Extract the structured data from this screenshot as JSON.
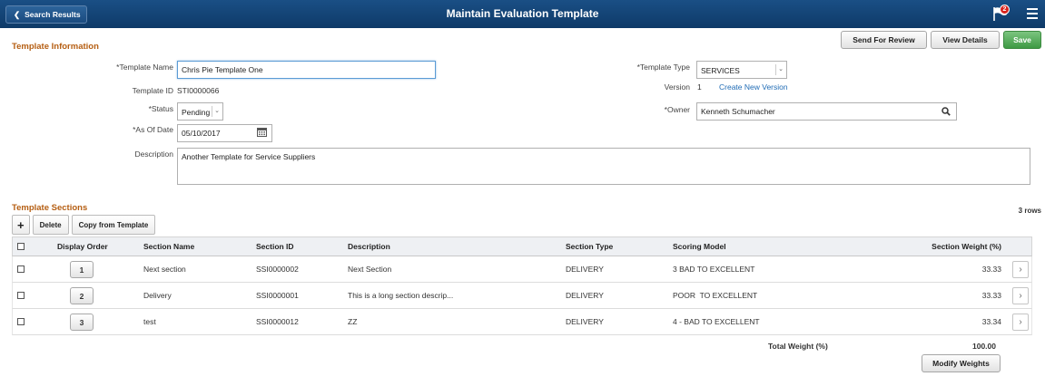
{
  "header": {
    "back_label": "Search Results",
    "title": "Maintain Evaluation Template",
    "notification_count": "2"
  },
  "actions": {
    "send_for_review": "Send For Review",
    "view_details": "View Details",
    "save": "Save"
  },
  "template_info": {
    "section_title": "Template Information",
    "template_name_label": "*Template Name",
    "template_name_value": "Chris Pie Template One",
    "template_id_label": "Template ID",
    "template_id_value": "STI0000066",
    "status_label": "*Status",
    "status_value": "Pending",
    "as_of_date_label": "*As Of Date",
    "as_of_date_value": "05/10/2017",
    "description_label": "Description",
    "description_value": "Another Template for Service Suppliers",
    "template_type_label": "*Template Type",
    "template_type_value": "SERVICES",
    "version_label": "Version",
    "version_value": "1",
    "create_new_version": "Create New Version",
    "owner_label": "*Owner",
    "owner_value": "Kenneth Schumacher"
  },
  "sections": {
    "title": "Template Sections",
    "rows_count": "3 rows",
    "add_icon": "plus-icon",
    "delete_label": "Delete",
    "copy_label": "Copy from Template",
    "columns": [
      "Display Order",
      "Section Name",
      "Section ID",
      "Description",
      "Section Type",
      "Scoring Model",
      "Section Weight (%)"
    ],
    "rows": [
      {
        "order": "1",
        "name": "Next section",
        "id": "SSI0000002",
        "description": "Next Section",
        "type": "DELIVERY",
        "scoring": "3 BAD TO EXCELLENT",
        "weight": "33.33"
      },
      {
        "order": "2",
        "name": "Delivery",
        "id": "SSI0000001",
        "description": "This is a long section descrip...",
        "type": "DELIVERY",
        "scoring": "POOR  TO EXCELLENT",
        "weight": "33.33"
      },
      {
        "order": "3",
        "name": "test",
        "id": "SSI0000012",
        "description": "ZZ",
        "type": "DELIVERY",
        "scoring": "4 - BAD TO EXCELLENT",
        "weight": "33.34"
      }
    ],
    "total_label": "Total Weight (%)",
    "total_value": "100.00",
    "modify_weights": "Modify Weights"
  },
  "colors": {
    "header_bg": "#0e3a68",
    "section_title": "#b55e12",
    "save_green": "#3e9a44",
    "link_blue": "#1f6bb5"
  }
}
